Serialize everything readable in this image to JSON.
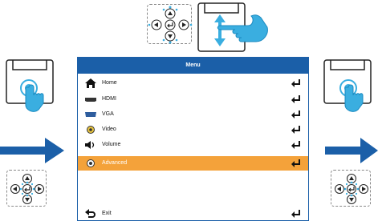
{
  "menu": {
    "title": "Menu",
    "items": [
      {
        "label": "Home",
        "icon": "home-icon"
      },
      {
        "label": "HDMI",
        "icon": "hdmi-icon"
      },
      {
        "label": "VGA",
        "icon": "vga-icon"
      },
      {
        "label": "Video",
        "icon": "video-icon"
      },
      {
        "label": "Volume",
        "icon": "volume-icon"
      },
      {
        "label": "Advanced",
        "icon": "advanced-icon",
        "selected": true
      },
      {
        "label": "Exit",
        "icon": "exit-icon"
      }
    ]
  },
  "colors": {
    "accent": "#1b5fa8",
    "selected": "#f4a23a",
    "touch": "#3aaee0",
    "arrow": "#1b5fa8"
  }
}
